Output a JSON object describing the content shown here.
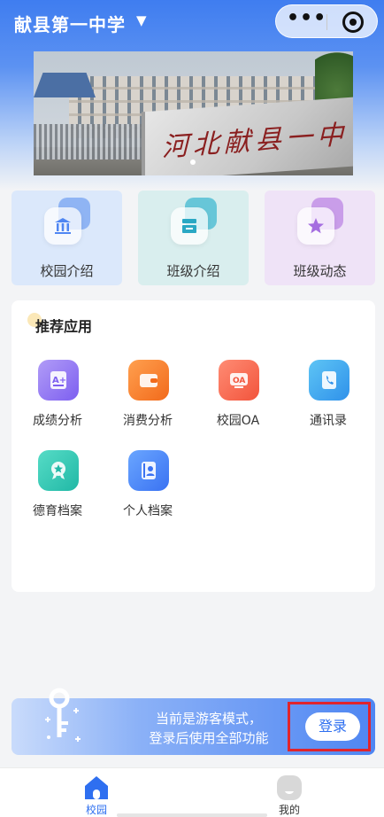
{
  "header": {
    "title": "献县第一中学",
    "title_caret": "▼",
    "capsule": {
      "more_label": "•••",
      "more_icon": "more-dots-icon",
      "close_icon": "target-circle-icon"
    }
  },
  "banner": {
    "stone_text": "河北献县一中",
    "active_slide": 1,
    "slide_count": 1
  },
  "quick_tiles": [
    {
      "label": "校园介绍",
      "icon": "bank-icon",
      "color": "#dbe8fb"
    },
    {
      "label": "班级介绍",
      "icon": "board-icon",
      "color": "#d9eeee"
    },
    {
      "label": "班级动态",
      "icon": "star-icon",
      "color": "#efe3f7"
    }
  ],
  "recommended": {
    "title": "推荐应用",
    "apps": [
      {
        "label": "成绩分析",
        "icon": "grade-a-plus-icon",
        "color": "#7d5ff0"
      },
      {
        "label": "消费分析",
        "icon": "wallet-icon",
        "color": "#f26a1b"
      },
      {
        "label": "校园OA",
        "icon": "oa-icon",
        "color": "#f2543c"
      },
      {
        "label": "通讯录",
        "icon": "phone-book-icon",
        "color": "#2f91ea"
      },
      {
        "label": "德育档案",
        "icon": "medal-icon",
        "color": "#21b8a6"
      },
      {
        "label": "个人档案",
        "icon": "profile-card-icon",
        "color": "#3a72f2"
      }
    ]
  },
  "guest_notice": {
    "line1": "当前是游客模式，",
    "line2": "登录后使用全部功能",
    "login_label": "登录",
    "icon": "key-icon"
  },
  "tabbar": {
    "items": [
      {
        "label": "校园",
        "icon": "home-icon",
        "active": true
      },
      {
        "label": "我的",
        "icon": "person-icon",
        "active": false
      }
    ]
  },
  "colors": {
    "accent": "#2e6ff0",
    "highlight_border": "#e0242c"
  }
}
